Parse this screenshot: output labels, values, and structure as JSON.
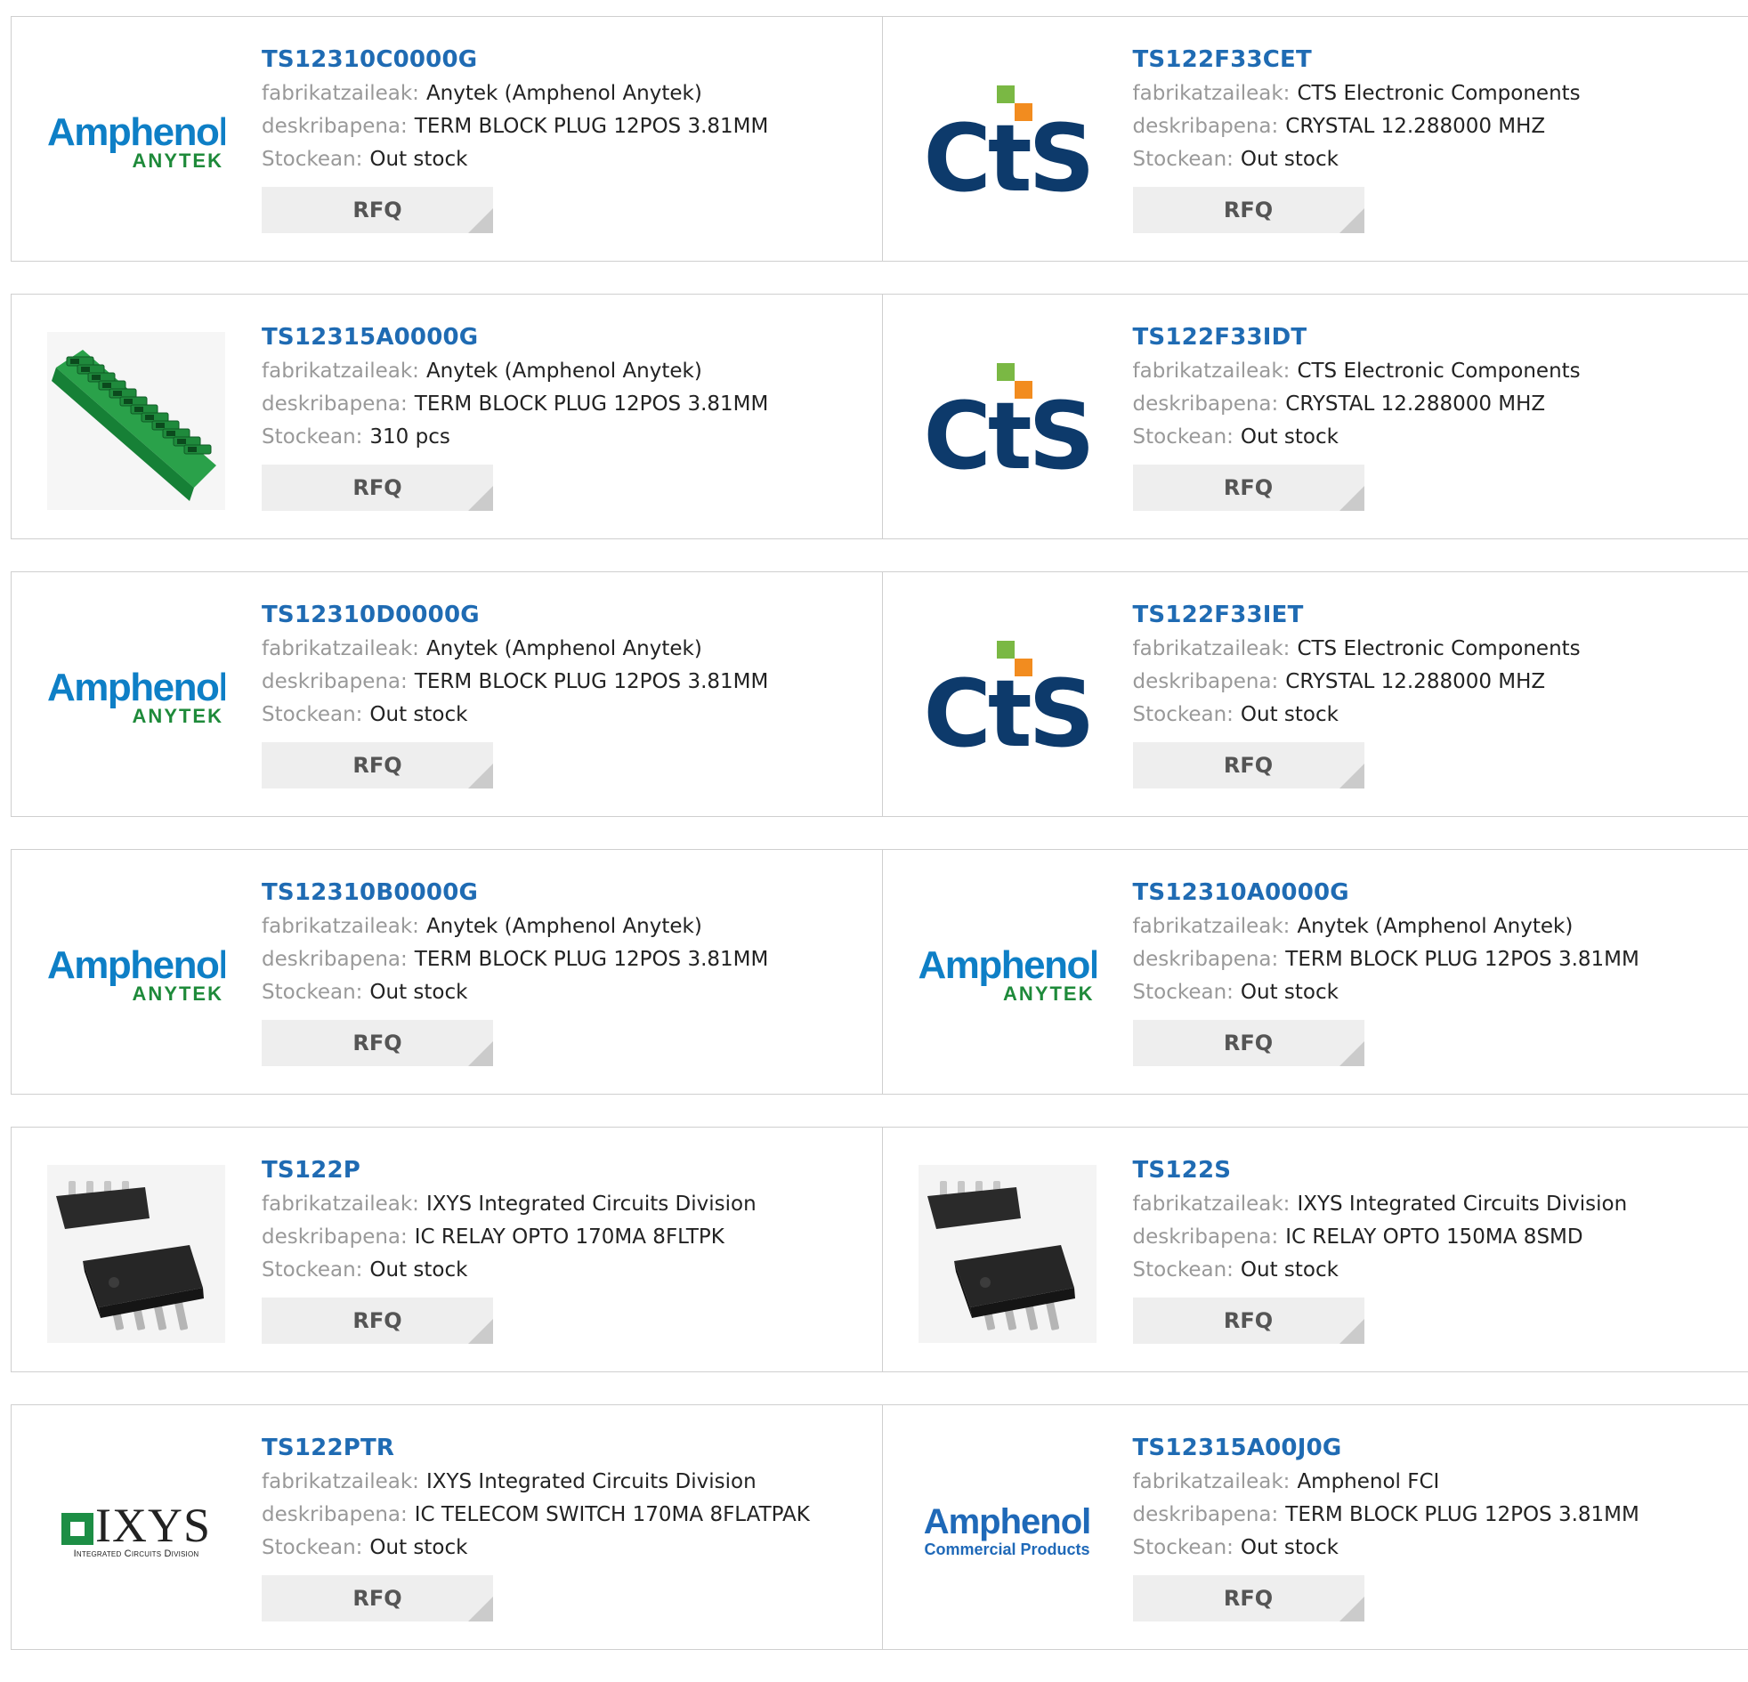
{
  "labels": {
    "manufacturer": "fabrikatzaileak:",
    "description": "deskribapena:",
    "stock": "Stockean:",
    "rfq": "RFQ"
  },
  "logos": {
    "amphenol_anytek": {
      "main": "Amphenol",
      "sub": "ANYTEK"
    },
    "cts": {
      "main": "CTS"
    },
    "amphenol_fci": {
      "main": "Amphenol",
      "sub": "Commercial Products"
    },
    "ixys": {
      "main": "IXYS",
      "sub": "Integrated Circuits Division"
    }
  },
  "colors": {
    "part_link": "#1f6bb3",
    "label_gray": "#999999",
    "rfq_bg": "#eeeeee",
    "border": "#cfcfcf",
    "amphenol_blue": "#0e7fc6",
    "anytek_green": "#1e8a3a",
    "cts_navy": "#0d3a6b",
    "cts_green": "#7ab844",
    "cts_orange": "#f28c1f",
    "relay_chip": "#2a2a2a"
  },
  "products": [
    {
      "part": "TS12310C0000G",
      "manufacturer": "Anytek (Amphenol Anytek)",
      "description": "TERM BLOCK PLUG 12POS 3.81MM",
      "stock": "Out stock",
      "image": "amphenol-anytek-logo"
    },
    {
      "part": "TS122F33CET",
      "manufacturer": "CTS Electronic Components",
      "description": "CRYSTAL 12.288000 MHZ",
      "stock": "Out stock",
      "image": "cts-logo"
    },
    {
      "part": "TS12315A0000G",
      "manufacturer": "Anytek (Amphenol Anytek)",
      "description": "TERM BLOCK PLUG 12POS 3.81MM",
      "stock": "310 pcs",
      "image": "terminal-block-photo"
    },
    {
      "part": "TS122F33IDT",
      "manufacturer": "CTS Electronic Components",
      "description": "CRYSTAL 12.288000 MHZ",
      "stock": "Out stock",
      "image": "cts-logo"
    },
    {
      "part": "TS12310D0000G",
      "manufacturer": "Anytek (Amphenol Anytek)",
      "description": "TERM BLOCK PLUG 12POS 3.81MM",
      "stock": "Out stock",
      "image": "amphenol-anytek-logo"
    },
    {
      "part": "TS122F33IET",
      "manufacturer": "CTS Electronic Components",
      "description": "CRYSTAL 12.288000 MHZ",
      "stock": "Out stock",
      "image": "cts-logo"
    },
    {
      "part": "TS12310B0000G",
      "manufacturer": "Anytek (Amphenol Anytek)",
      "description": "TERM BLOCK PLUG 12POS 3.81MM",
      "stock": "Out stock",
      "image": "amphenol-anytek-logo"
    },
    {
      "part": "TS12310A0000G",
      "manufacturer": "Anytek (Amphenol Anytek)",
      "description": "TERM BLOCK PLUG 12POS 3.81MM",
      "stock": "Out stock",
      "image": "amphenol-anytek-logo"
    },
    {
      "part": "TS122P",
      "manufacturer": "IXYS Integrated Circuits Division",
      "description": "IC RELAY OPTO 170MA 8FLTPK",
      "stock": "Out stock",
      "image": "relay-ic-photo"
    },
    {
      "part": "TS122S",
      "manufacturer": "IXYS Integrated Circuits Division",
      "description": "IC RELAY OPTO 150MA 8SMD",
      "stock": "Out stock",
      "image": "relay-ic-photo"
    },
    {
      "part": "TS122PTR",
      "manufacturer": "IXYS Integrated Circuits Division",
      "description": "IC TELECOM SWITCH 170MA 8FLATPAK",
      "stock": "Out stock",
      "image": "ixys-logo"
    },
    {
      "part": "TS12315A00J0G",
      "manufacturer": "Amphenol FCI",
      "description": "TERM BLOCK PLUG 12POS 3.81MM",
      "stock": "Out stock",
      "image": "amphenol-fci-logo"
    }
  ]
}
